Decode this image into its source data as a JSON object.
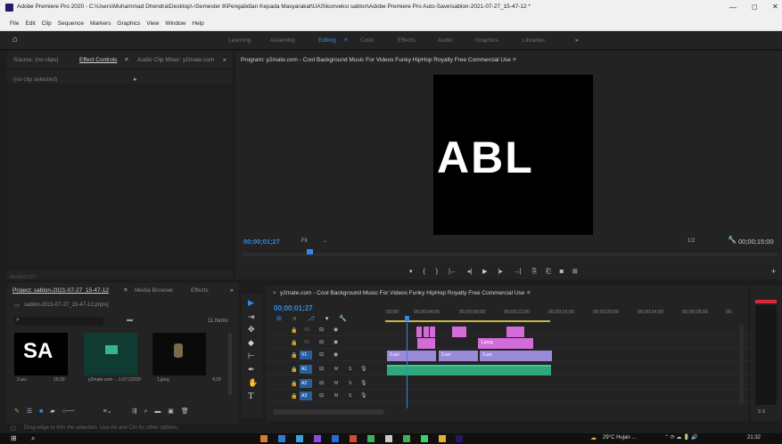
{
  "window": {
    "title": "Adobe Premiere Pro 2020 - C:\\Users\\Muhammad Dhendra\\Desktop\\-\\Semester 8\\Pengabdian Kepada Masyarakat\\UAS\\konveksi sablon\\Adobe Premiere Pro Auto-Save\\sablon-2021-07-27_15-47-12 *",
    "minimize": "—",
    "maximize": "◻",
    "close": "✕"
  },
  "menu": [
    "File",
    "Edit",
    "Clip",
    "Sequence",
    "Markers",
    "Graphics",
    "View",
    "Window",
    "Help"
  ],
  "workspaces": {
    "items": [
      "Learning",
      "Assembly",
      "Editing",
      "Color",
      "Effects",
      "Audio",
      "Graphics",
      "Libraries"
    ],
    "active": "Editing",
    "more": "»",
    "active_menu": "≡"
  },
  "source_panel": {
    "tabs": [
      "Source: (no clips)",
      "Effect Controls",
      "Audio Clip Mixer: y2mate.com"
    ],
    "active": "Effect Controls",
    "menu": "≡",
    "more": "»",
    "no_clip": "(no clip selected)",
    "timecode": "00;00;01;27",
    "expand": "▸"
  },
  "program": {
    "title": "Program: y2mate.com - Cool Background Music For Videos  Funky HipHop Royalty Free  Commercial Use",
    "menu": "≡",
    "timecode": "00;00;01;27",
    "fit": "Fit",
    "fraction": "1/2",
    "duration": "00;00;15;00",
    "video_text": "ABL"
  },
  "transport": [
    "▾",
    "{",
    "}",
    "|←",
    "◂|",
    "▶",
    "|▸",
    "→|",
    "⎘",
    "⎗",
    "◙",
    "⊞"
  ],
  "project": {
    "tabs": [
      "Project: sablon-2021-07-27_15-47-12",
      "Media Browser",
      "Effects"
    ],
    "active": "Project: sablon-2021-07-27_15-47-12",
    "menu": "≡",
    "more": "»",
    "file": "sablon-2021-07-27_15-47-12.prproj",
    "items_count": "11 Items",
    "search": "",
    "items": [
      {
        "name": "2.avi",
        "dur": "15;00",
        "thumb": "SA"
      },
      {
        "name": "y2mate.com -...",
        "dur": "1:07:23220",
        "thumb": ""
      },
      {
        "name": "1.jpeg",
        "dur": "4;29",
        "thumb": ""
      }
    ]
  },
  "timeline": {
    "title": "y2mate.com - Cool Background Music For Videos  Funky HipHop Royalty Free  Commercial Use",
    "menu": "≡",
    "close": "×",
    "timecode": "00;00;01;27",
    "ruler": [
      ":00;00",
      "00;00;04;00",
      "00;00;08;00",
      "00;00;12;00",
      "00;00;16;00",
      "00;00;20;00",
      "00;00;24;00",
      "00;00;28;00",
      "00;"
    ],
    "tracks": [
      {
        "label": "V3"
      },
      {
        "label": "V2"
      },
      {
        "label": "V1"
      },
      {
        "label": "A1"
      },
      {
        "label": "A2"
      },
      {
        "label": "A3"
      }
    ],
    "clips": {
      "v2": "1.jpeg",
      "v1a": "2.avi",
      "v1b": "2.avi",
      "v1c": "2.avi"
    },
    "track_mute": "M",
    "track_solo": "S",
    "meter": "S S"
  },
  "status": {
    "text": "Drag edge to trim the selection. Use Alt and Ctrl for other options."
  },
  "taskbar": {
    "weather": "29°C  Hujan ...",
    "time": "21:32"
  },
  "colors": {
    "accent": "#2d8ceb",
    "video_clip": "#9a8ad8",
    "pink_clip": "#d36bd8",
    "audio_clip": "#2ea87a",
    "playhead": "#2d8ceb"
  }
}
